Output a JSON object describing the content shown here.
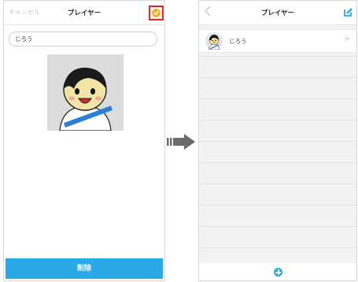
{
  "left_screen": {
    "nav": {
      "cancel_label": "キャンセル",
      "title": "プレイヤー",
      "confirm_icon": "check-circle-icon"
    },
    "name_value": "じろう",
    "delete_label": "削除",
    "colors": {
      "accent": "#2aa9e6",
      "confirm": "#f4b22a",
      "highlight": "#e0261f"
    }
  },
  "right_screen": {
    "nav": {
      "back_icon": "chevron-left-icon",
      "title": "プレイヤー",
      "edit_icon": "edit-icon"
    },
    "players": [
      {
        "name": "じろう",
        "chevron": ">"
      }
    ],
    "add_icon": "plus-circle-icon"
  },
  "transition_icon": "arrow-right-icon"
}
